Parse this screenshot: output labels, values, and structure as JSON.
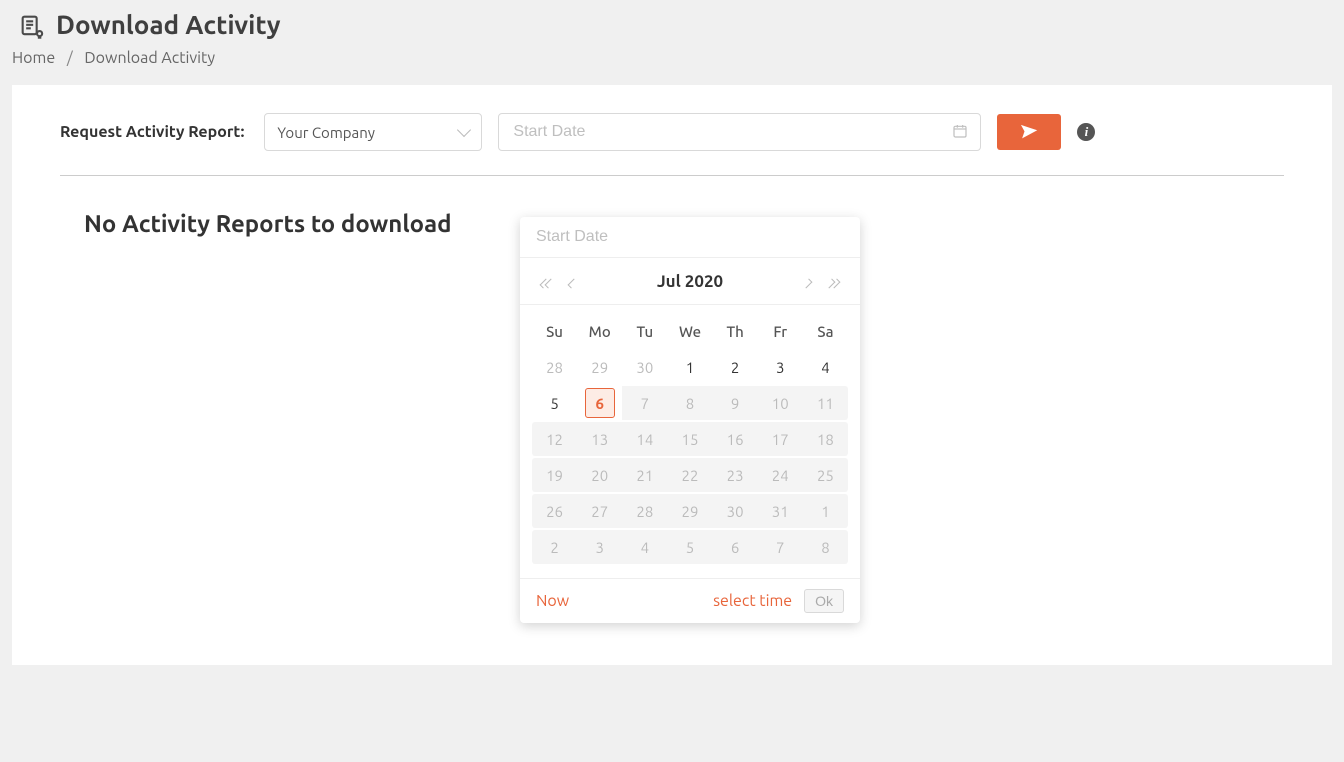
{
  "header": {
    "title": "Download Activity"
  },
  "breadcrumb": {
    "home": "Home",
    "current": "Download Activity"
  },
  "form": {
    "label": "Request Activity Report:",
    "company_select": "Your Company",
    "start_date_placeholder": "Start Date"
  },
  "body": {
    "empty_message": "No Activity Reports to download"
  },
  "picker": {
    "input_placeholder": "Start Date",
    "month_label": "Jul 2020",
    "weekdays": [
      "Su",
      "Mo",
      "Tu",
      "We",
      "Th",
      "Fr",
      "Sa"
    ],
    "weeks": [
      {
        "disabled": false,
        "days": [
          {
            "n": "28",
            "state": "out"
          },
          {
            "n": "29",
            "state": "out"
          },
          {
            "n": "30",
            "state": "out"
          },
          {
            "n": "1",
            "state": "in"
          },
          {
            "n": "2",
            "state": "in"
          },
          {
            "n": "3",
            "state": "in"
          },
          {
            "n": "4",
            "state": "in"
          }
        ]
      },
      {
        "disabled": true,
        "days": [
          {
            "n": "5",
            "state": "in",
            "rowbg": false
          },
          {
            "n": "6",
            "state": "today",
            "rowbg": false
          },
          {
            "n": "7",
            "state": "disabled"
          },
          {
            "n": "8",
            "state": "disabled"
          },
          {
            "n": "9",
            "state": "disabled"
          },
          {
            "n": "10",
            "state": "disabled"
          },
          {
            "n": "11",
            "state": "disabled"
          }
        ]
      },
      {
        "disabled": true,
        "days": [
          {
            "n": "12",
            "state": "disabled"
          },
          {
            "n": "13",
            "state": "disabled"
          },
          {
            "n": "14",
            "state": "disabled"
          },
          {
            "n": "15",
            "state": "disabled"
          },
          {
            "n": "16",
            "state": "disabled"
          },
          {
            "n": "17",
            "state": "disabled"
          },
          {
            "n": "18",
            "state": "disabled"
          }
        ]
      },
      {
        "disabled": true,
        "days": [
          {
            "n": "19",
            "state": "disabled"
          },
          {
            "n": "20",
            "state": "disabled"
          },
          {
            "n": "21",
            "state": "disabled"
          },
          {
            "n": "22",
            "state": "disabled"
          },
          {
            "n": "23",
            "state": "disabled"
          },
          {
            "n": "24",
            "state": "disabled"
          },
          {
            "n": "25",
            "state": "disabled"
          }
        ]
      },
      {
        "disabled": true,
        "days": [
          {
            "n": "26",
            "state": "disabled"
          },
          {
            "n": "27",
            "state": "disabled"
          },
          {
            "n": "28",
            "state": "disabled"
          },
          {
            "n": "29",
            "state": "disabled"
          },
          {
            "n": "30",
            "state": "disabled"
          },
          {
            "n": "31",
            "state": "disabled"
          },
          {
            "n": "1",
            "state": "disabled"
          }
        ]
      },
      {
        "disabled": true,
        "days": [
          {
            "n": "2",
            "state": "disabled"
          },
          {
            "n": "3",
            "state": "disabled"
          },
          {
            "n": "4",
            "state": "disabled"
          },
          {
            "n": "5",
            "state": "disabled"
          },
          {
            "n": "6",
            "state": "disabled"
          },
          {
            "n": "7",
            "state": "disabled"
          },
          {
            "n": "8",
            "state": "disabled"
          }
        ]
      }
    ],
    "now_label": "Now",
    "select_time_label": "select time",
    "ok_label": "Ok"
  }
}
